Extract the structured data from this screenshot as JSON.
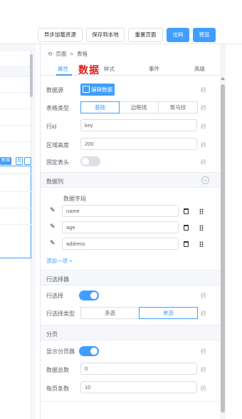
{
  "toolbar": {
    "buttons": [
      {
        "label": "异步加载资源",
        "primary": false
      },
      {
        "label": "保存到本地",
        "primary": false
      },
      {
        "label": "重置页面",
        "primary": false
      },
      {
        "label": "出码",
        "primary": true
      },
      {
        "label": "预览",
        "primary": true
      }
    ]
  },
  "breadcrumb": {
    "root": "页面",
    "sep": ">",
    "current": "表格"
  },
  "tabs": [
    "属性",
    "样式",
    "事件",
    "高级"
  ],
  "annotation_text": "数据",
  "props": {
    "datasource": {
      "label": "数据源",
      "button": "编辑数据",
      "fx": "{/}"
    },
    "table_type": {
      "label": "表格类型",
      "options": [
        "基础",
        "边框线",
        "斑马纹"
      ],
      "selected": "基础",
      "fx": "{/}"
    },
    "row_id": {
      "label": "行id",
      "value": "key",
      "fx": "{/}"
    },
    "area_height": {
      "label": "区域高度",
      "value": "200",
      "fx": "{/}"
    },
    "fixed_header": {
      "label": "固定表头",
      "on": false,
      "fx": "{/}"
    }
  },
  "columns_section": {
    "title": "数据列",
    "header": "数据字段",
    "fields": [
      "name",
      "age",
      "address"
    ],
    "add_label": "添加一项 +"
  },
  "row_selector": {
    "title": "行选择器",
    "select_label": "行选择",
    "select_on": true,
    "select_fx": "{/}",
    "type_label": "行选择类型",
    "type_options": [
      "多选",
      "单选"
    ],
    "type_selected": "单选",
    "type_fx": "{/}"
  },
  "pagination": {
    "title": "分页",
    "show_label": "显示分页器",
    "show_on": true,
    "show_fx": "{/}",
    "total_label": "数据总数",
    "total_value": "0",
    "total_fx": "{/}",
    "page_size_label": "每页条数",
    "page_size_value": "10",
    "page_size_fx": "{/}"
  },
  "canvas": {
    "mini_action": "新增",
    "icon_label": "目"
  },
  "colors": {
    "primary": "#409eff",
    "annotation": "#e02020",
    "border": "#dcdfe6"
  }
}
